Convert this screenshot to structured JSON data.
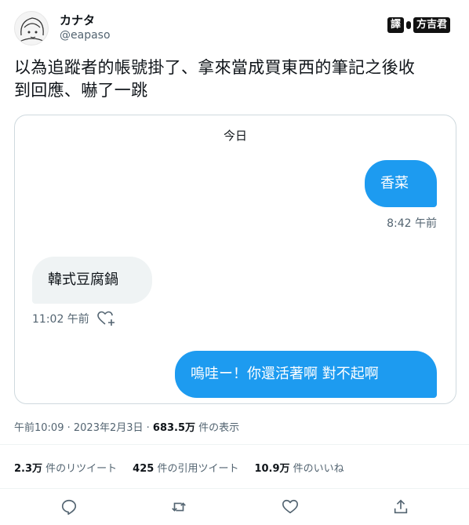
{
  "user": {
    "display_name": "カナタ",
    "handle": "@eapaso"
  },
  "watermark": {
    "left": "譯",
    "right": "方吉君"
  },
  "tweet": {
    "text_line1": "以為追蹤者的帳號掛了、拿來當成買東西的筆記之後收",
    "text_line2": "到回應、嚇了一跳"
  },
  "chat": {
    "day_label": "今日",
    "messages": [
      {
        "from": "me",
        "text": "香菜",
        "time": "8:42 午前"
      },
      {
        "from": "them",
        "text": "韓式豆腐鍋",
        "time": "11:02 午前"
      },
      {
        "from": "me",
        "text": "嗚哇ー！你還活著啊 對不起啊",
        "time": ""
      }
    ]
  },
  "meta": {
    "time": "午前10:09",
    "sep": " · ",
    "date": "2023年2月3日",
    "views": "683.5万",
    "views_suffix": " 件の表示"
  },
  "stats": {
    "retweets": "2.3万",
    "retweets_label": " 件のリツイート",
    "quotes": "425",
    "quotes_label": " 件の引用ツイート",
    "likes": "10.9万",
    "likes_label": " 件のいいね"
  },
  "colors": {
    "accent": "#1d9bf0",
    "bubble_other": "#eff3f4",
    "muted": "#536471",
    "text": "#0f1419"
  },
  "icons": [
    "reply-icon",
    "retweet-icon",
    "like-icon",
    "share-icon",
    "add-reaction-icon"
  ]
}
